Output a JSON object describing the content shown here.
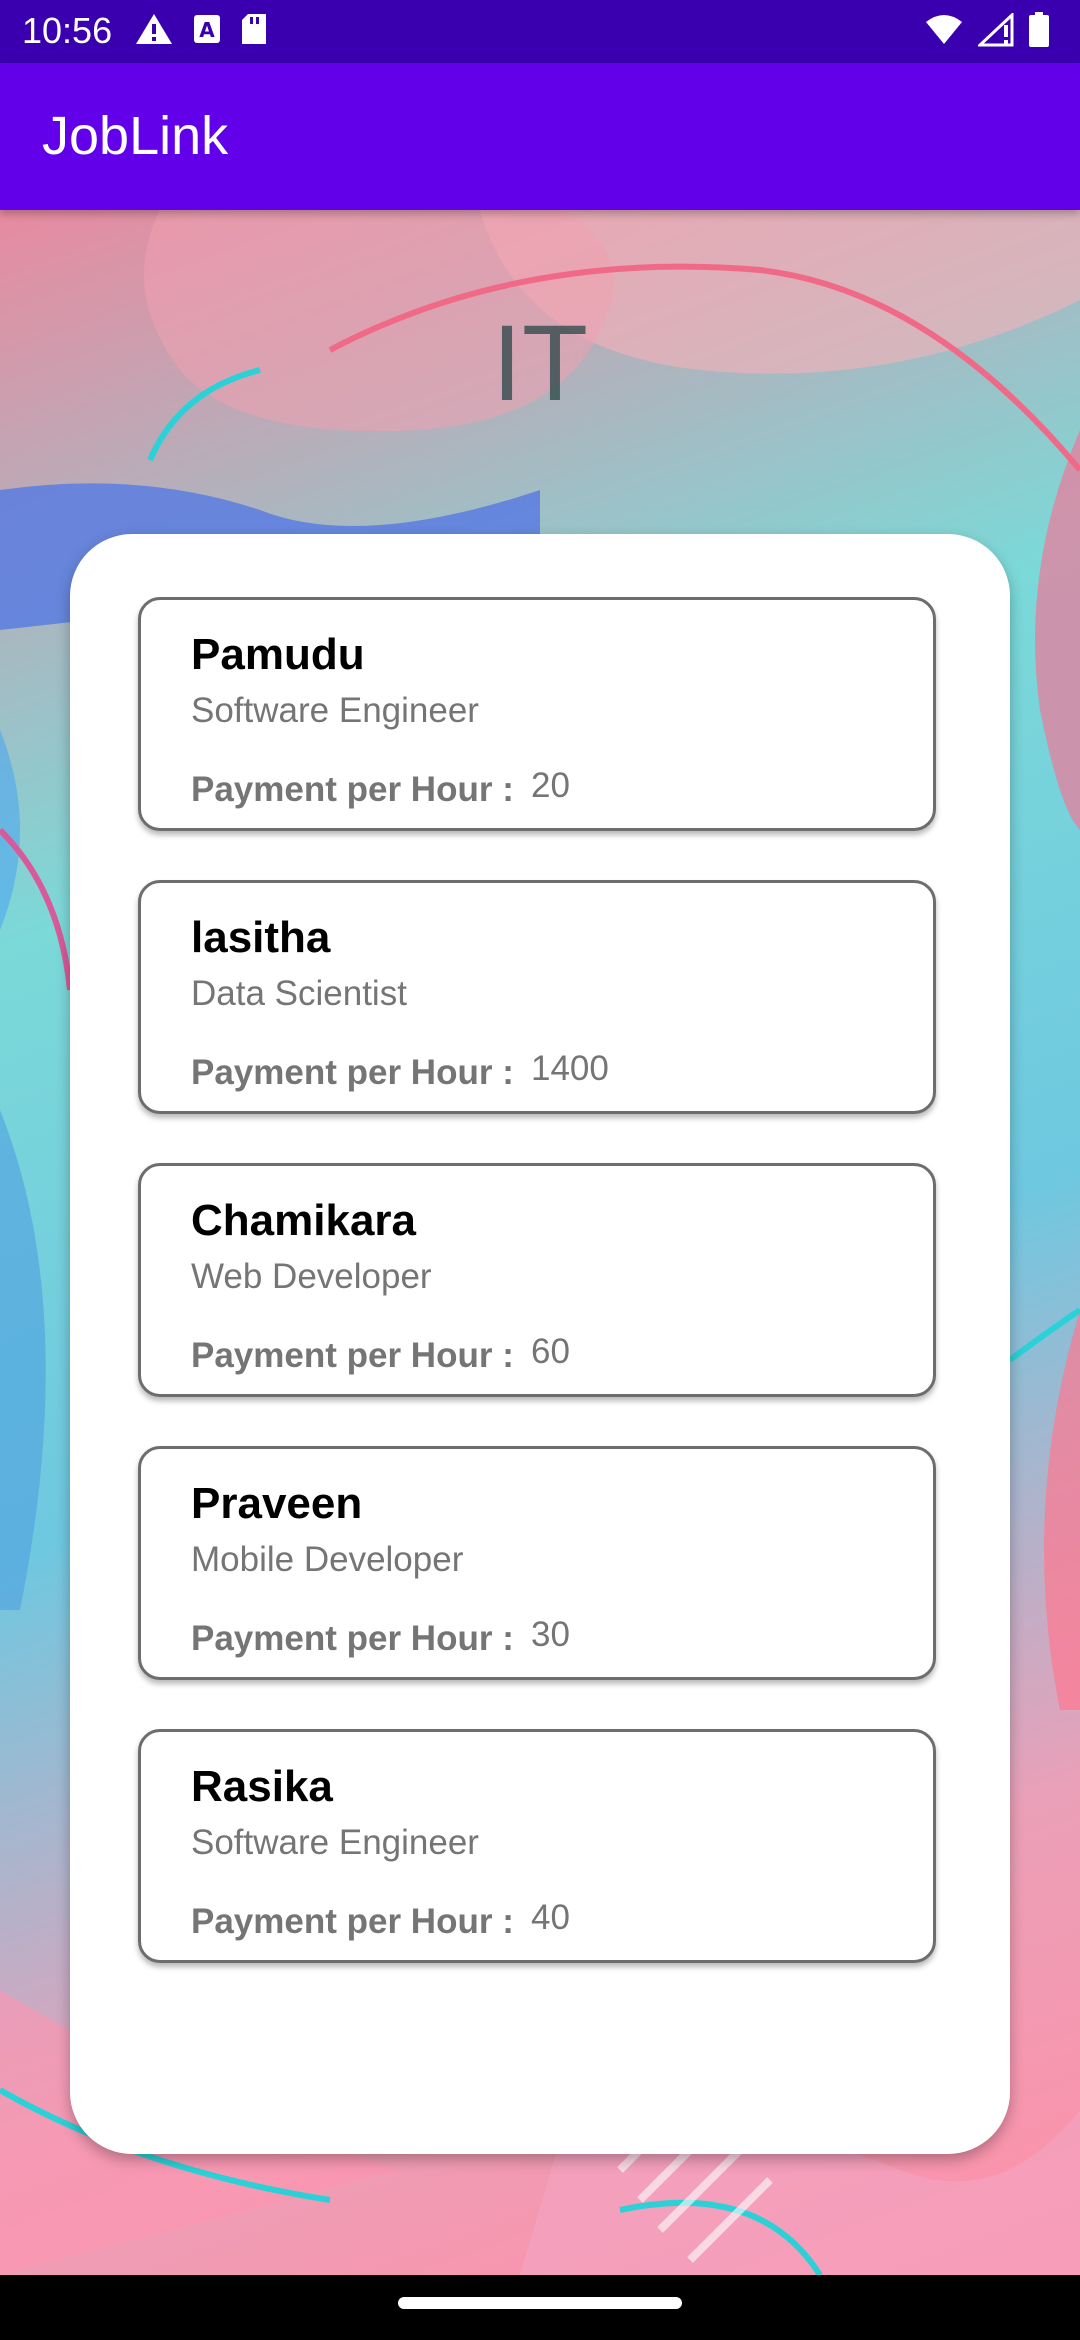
{
  "status_bar": {
    "time": "10:56",
    "left_icons": [
      "warning-icon",
      "text-a-icon",
      "sd-card-icon"
    ],
    "right_icons": [
      "wifi-icon",
      "signal-icon",
      "battery-icon"
    ]
  },
  "app_bar": {
    "title": "JobLink",
    "color": "#6200ea"
  },
  "category": {
    "title": "IT"
  },
  "cards": [
    {
      "name": "Pamudu",
      "role": "Software Engineer",
      "pay_label": "Payment per Hour :",
      "pay_value": "20"
    },
    {
      "name": "lasitha",
      "role": "Data Scientist",
      "pay_label": "Payment per Hour :",
      "pay_value": "1400"
    },
    {
      "name": "Chamikara",
      "role": "Web Developer",
      "pay_label": "Payment per Hour :",
      "pay_value": "60"
    },
    {
      "name": "Praveen",
      "role": "Mobile Developer",
      "pay_label": "Payment per Hour :",
      "pay_value": "30"
    },
    {
      "name": "Rasika",
      "role": "Software Engineer",
      "pay_label": "Payment per Hour :",
      "pay_value": "40"
    }
  ]
}
